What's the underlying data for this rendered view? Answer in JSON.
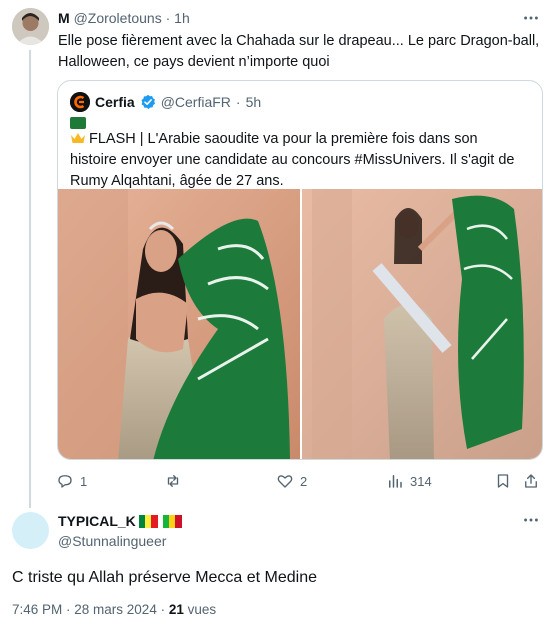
{
  "tweet1": {
    "name": "M",
    "handle": "@Zoroletouns",
    "sep": "·",
    "time": "1h",
    "text_line1": "Elle pose fièrement avec la Chahada sur le drapeau... Le parc Dragon-ball,",
    "text_line2": "Halloween, ce pays devient n’importe quoi",
    "quote": {
      "name": "Cerfia",
      "handle": "@CerfiaFR",
      "sep": "·",
      "time": "5h",
      "line1": "FLASH | L'Arabie saoudite va pour la première fois dans son",
      "line2": "histoire envoyer une candidate au concours #MissUnivers. Il s'agit de",
      "line3": "Rumy Alqahtani, âgée de 27 ans."
    },
    "actions": {
      "reply_count": "1",
      "like_count": "2",
      "views_count": "314"
    }
  },
  "tweet2": {
    "name": "TYPICAL_K",
    "handle": "@Stunnalingueer",
    "text": "C triste qu Allah préserve Mecca et Medine",
    "time": "7:46 PM · 28 mars 2024 · ",
    "views_count": "21",
    "views_label": " vues"
  },
  "colors": {
    "text": "#0f1419",
    "muted": "#536471",
    "border": "#cfd9de",
    "verified": "#1d9bf0",
    "flag_green": "#1f7a3a"
  },
  "icons": [
    "more-icon",
    "cerfia-logo",
    "verified-icon",
    "reply-icon",
    "retweet-icon",
    "like-icon",
    "views-icon",
    "bookmark-icon",
    "share-icon"
  ]
}
